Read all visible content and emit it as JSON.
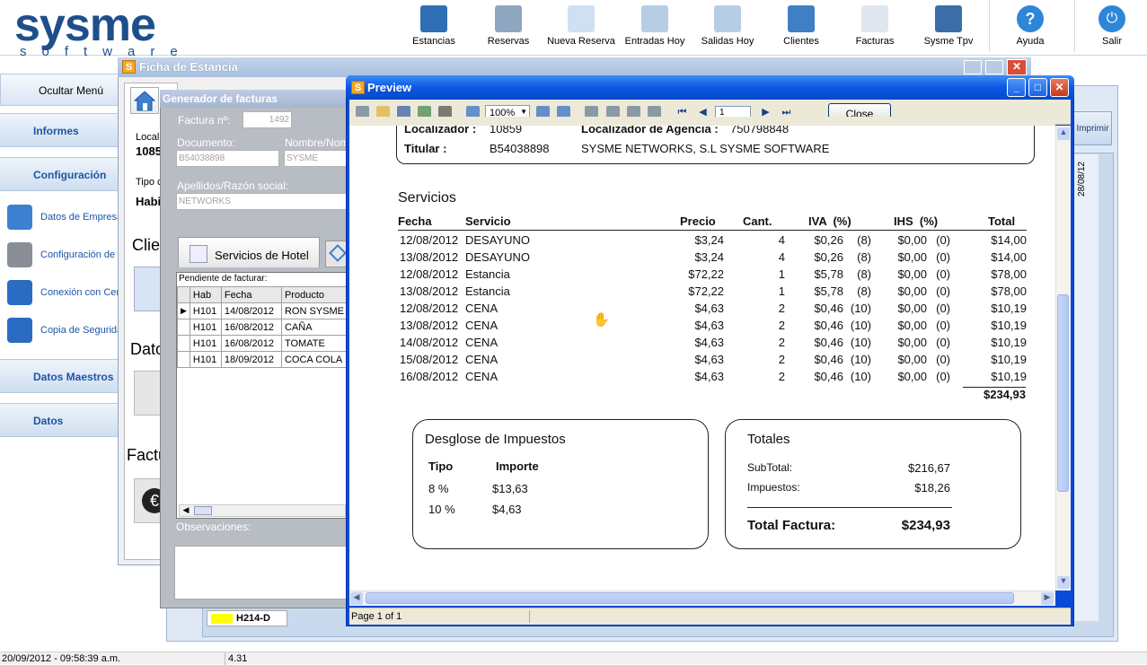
{
  "app": {
    "logo": "sysme",
    "logo_sub": "software"
  },
  "toolbar": [
    {
      "label": "Estancias",
      "icon": "folder-person-icon",
      "color": "#2f6fb3"
    },
    {
      "label": "Reservas",
      "icon": "cabinet-icon",
      "color": "#8fa6c0"
    },
    {
      "label": "Nueva Reserva",
      "icon": "new-document-icon",
      "color": "#cfe0f2"
    },
    {
      "label": "Entradas Hoy",
      "icon": "document-in-icon",
      "color": "#b7cde6"
    },
    {
      "label": "Salidas Hoy",
      "icon": "document-out-icon",
      "color": "#b7cde6"
    },
    {
      "label": "Clientes",
      "icon": "address-book-icon",
      "color": "#3f7fc4"
    },
    {
      "label": "Facturas",
      "icon": "invoice-icon",
      "color": "#dfe6ee"
    },
    {
      "label": "Sysme Tpv",
      "icon": "cart-icon",
      "color": "#3b6ea8"
    },
    {
      "label": "Ayuda",
      "icon": "help-icon",
      "color": "#2d86d8"
    },
    {
      "label": "Salir",
      "icon": "power-icon",
      "color": "#2d86d8"
    }
  ],
  "left_menu": {
    "hide_label": "Ocultar Menú",
    "sections": [
      "Informes",
      "Configuración",
      "Datos Maestros",
      "Datos"
    ],
    "items": [
      {
        "label": "Datos de Empresa",
        "icon": "home-icon",
        "color": "#3d7fd0"
      },
      {
        "label": "Configuración de",
        "icon": "tools-icon",
        "color": "#8a8f96"
      },
      {
        "label": "Conexión con Cen",
        "icon": "phone-icon",
        "color": "#2a6cc2"
      },
      {
        "label": "Copia de Seguridad",
        "icon": "database-icon",
        "color": "#2a6cc2"
      }
    ]
  },
  "ficha": {
    "title": "Ficha de Estancia",
    "labels": [
      "Local",
      "1085",
      "Tipo c",
      "Habi",
      "Clien",
      "Dato",
      "Factu"
    ]
  },
  "calendar": {
    "print_label": "Imprimir",
    "date_col": "28/08/12",
    "room": "H214-D"
  },
  "generador": {
    "title": "Generador de facturas",
    "factura_label": "Factura nº:",
    "factura_value": "1492",
    "documento_label": "Documento:",
    "documento_value": "B54038898",
    "nombre_label": "Nombre/Nombre",
    "nombre_value": "SYSME",
    "apellidos_label": "Apellidos/Razón social:",
    "apellidos_value": "NETWORKS",
    "tab_label": "Servicios de Hotel",
    "pending_label": "Pendiente de facturar:",
    "columns": [
      "Hab",
      "Fecha",
      "Producto"
    ],
    "rows": [
      [
        "H101",
        "14/08/2012",
        "RON SYSME"
      ],
      [
        "H101",
        "16/08/2012",
        "CAÑA"
      ],
      [
        "H101",
        "16/08/2012",
        "TOMATE"
      ],
      [
        "H101",
        "18/09/2012",
        "COCA COLA"
      ]
    ],
    "observaciones_label": "Observaciones:"
  },
  "preview": {
    "title": "Preview",
    "zoom": "100%",
    "page": "1",
    "close_label": "Close",
    "status": "Page 1 of 1",
    "report": {
      "localizador_label": "Localizador :",
      "localizador_value": "10859",
      "agencia_label": "Localizador de Agencia :",
      "agencia_value": "750798848",
      "titular_label": "Titular :",
      "titular_doc": "B54038898",
      "titular_name": "SYSME NETWORKS, S.L SYSME SOFTWARE",
      "servicios_title": "Servicios",
      "headers": [
        "Fecha",
        "Servicio",
        "Precio",
        "Cant.",
        "IVA  (%)",
        "IHS  (%)",
        "Total"
      ],
      "rows": [
        [
          "12/08/2012",
          "DESAYUNO",
          "$3,24",
          "4",
          "$0,26",
          "(8)",
          "$0,00",
          "(0)",
          "$14,00"
        ],
        [
          "13/08/2012",
          "DESAYUNO",
          "$3,24",
          "4",
          "$0,26",
          "(8)",
          "$0,00",
          "(0)",
          "$14,00"
        ],
        [
          "12/08/2012",
          "Estancia",
          "$72,22",
          "1",
          "$5,78",
          "(8)",
          "$0,00",
          "(0)",
          "$78,00"
        ],
        [
          "13/08/2012",
          "Estancia",
          "$72,22",
          "1",
          "$5,78",
          "(8)",
          "$0,00",
          "(0)",
          "$78,00"
        ],
        [
          "12/08/2012",
          "CENA",
          "$4,63",
          "2",
          "$0,46",
          "(10)",
          "$0,00",
          "(0)",
          "$10,19"
        ],
        [
          "13/08/2012",
          "CENA",
          "$4,63",
          "2",
          "$0,46",
          "(10)",
          "$0,00",
          "(0)",
          "$10,19"
        ],
        [
          "14/08/2012",
          "CENA",
          "$4,63",
          "2",
          "$0,46",
          "(10)",
          "$0,00",
          "(0)",
          "$10,19"
        ],
        [
          "15/08/2012",
          "CENA",
          "$4,63",
          "2",
          "$0,46",
          "(10)",
          "$0,00",
          "(0)",
          "$10,19"
        ],
        [
          "16/08/2012",
          "CENA",
          "$4,63",
          "2",
          "$0,46",
          "(10)",
          "$0,00",
          "(0)",
          "$10,19"
        ]
      ],
      "grand_total": "$234,93",
      "desglose_title": "Desglose de Impuestos",
      "desglose_headers": [
        "Tipo",
        "Importe"
      ],
      "desglose_rows": [
        [
          "8 %",
          "$13,63"
        ],
        [
          "10 %",
          "$4,63"
        ]
      ],
      "totales_title": "Totales",
      "subtotal_label": "SubTotal:",
      "subtotal_value": "$216,67",
      "impuestos_label": "Impuestos:",
      "impuestos_value": "$18,26",
      "total_label": "Total Factura:",
      "total_value": "$234,93"
    }
  },
  "statusbar": {
    "datetime": "20/09/2012 - 09:58:39 a.m.",
    "version": "4.31"
  }
}
